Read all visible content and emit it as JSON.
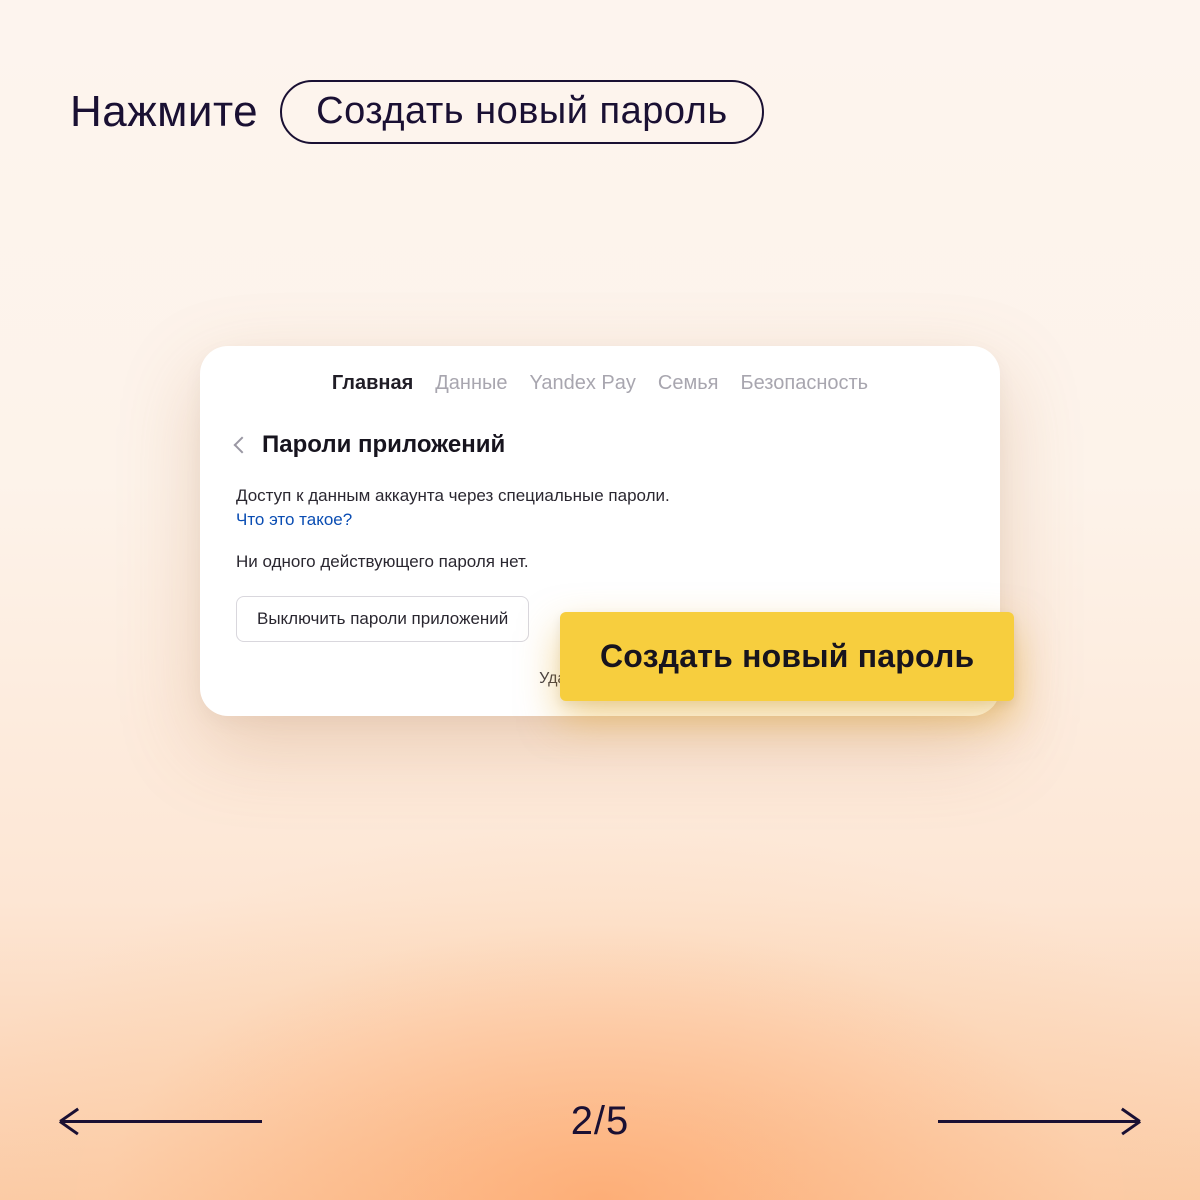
{
  "instruction": {
    "verb": "Нажмите",
    "target": "Создать новый пароль"
  },
  "card": {
    "tabs": [
      "Главная",
      "Данные",
      "Yandex Pay",
      "Семья",
      "Безопасность"
    ],
    "active_tab_index": 0,
    "section_title": "Пароли приложений",
    "description": "Доступ к данным аккаунта через специальные пароли.",
    "what_is_this": "Что это такое?",
    "empty_state": "Ни одного действующего пароля нет.",
    "disable_button": "Выключить пароли приложений",
    "delete_account": "Удалить аккаунт"
  },
  "cta_label": "Создать новый пароль",
  "pager": {
    "current": 2,
    "total": 5,
    "label": "2/5"
  },
  "colors": {
    "accent_yellow": "#f7ce3e",
    "ink": "#1a1033",
    "link": "#0a4db3"
  }
}
